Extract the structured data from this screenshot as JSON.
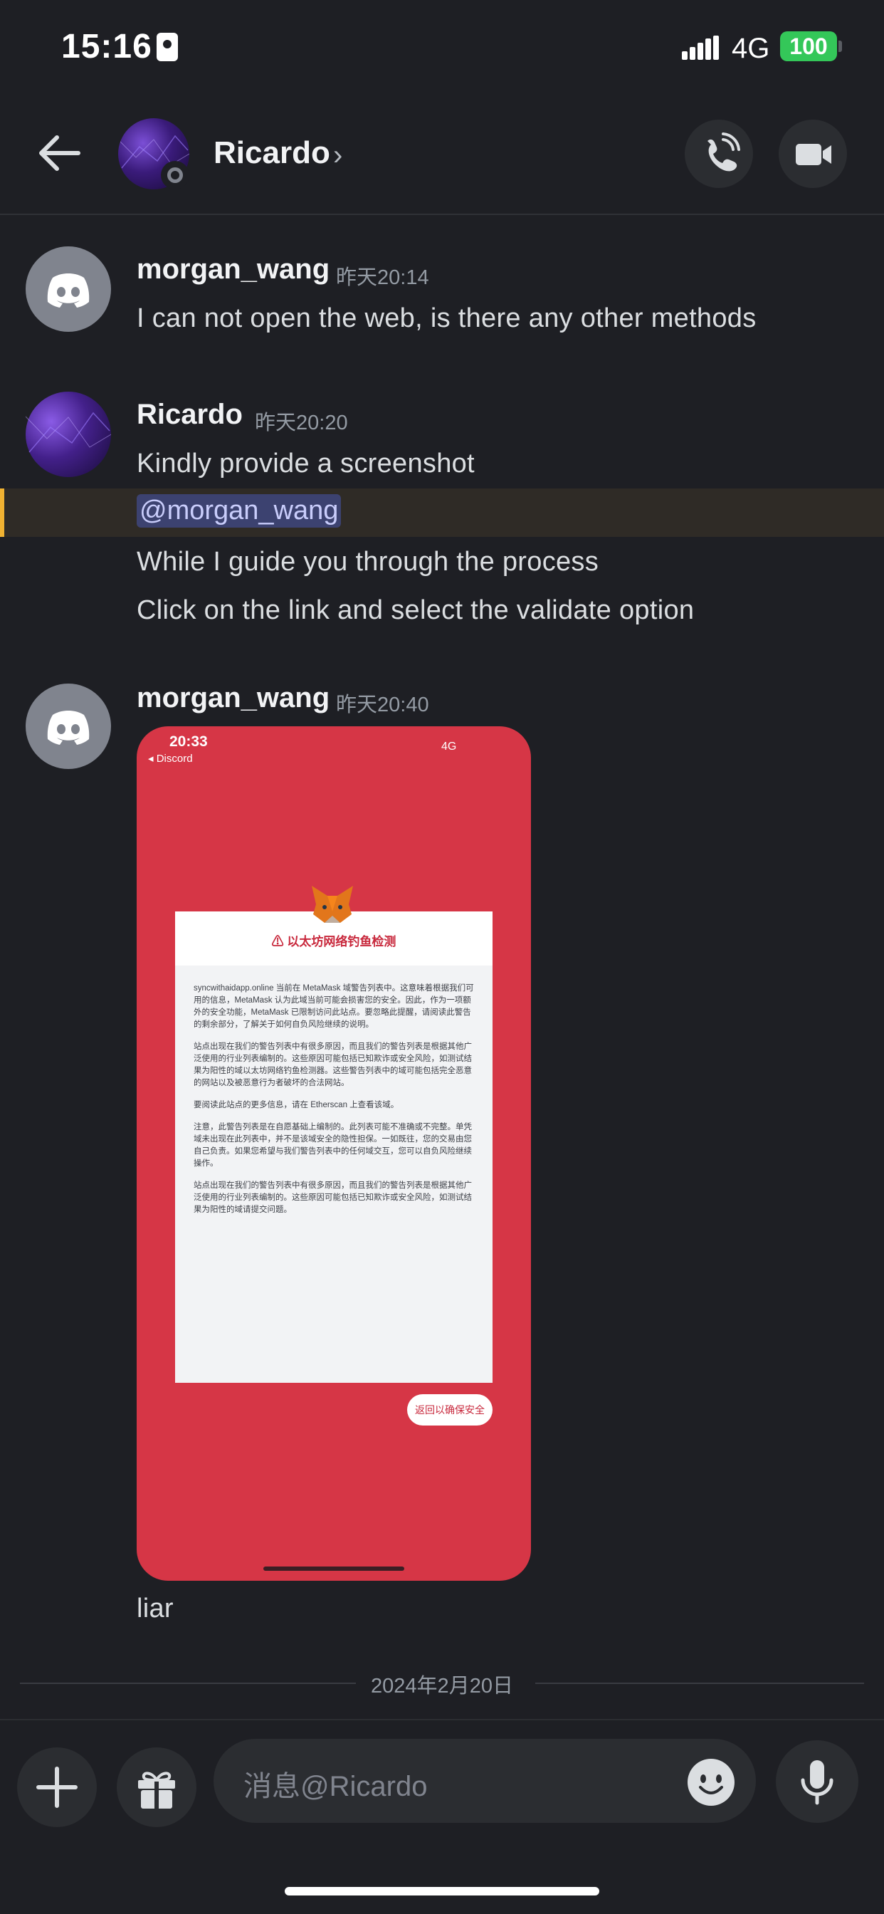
{
  "status_bar": {
    "time": "15:16",
    "network": "4G",
    "battery": "100"
  },
  "header": {
    "contact_name": "Ricardo",
    "chevron": "›"
  },
  "messages": [
    {
      "username": "morgan_wang",
      "timestamp": "昨天20:14",
      "lines": [
        "I can not open the web, is there any other methods"
      ]
    },
    {
      "username": "Ricardo",
      "timestamp": "昨天20:20",
      "lines": [
        "Kindly provide a screenshot",
        "@morgan_wang",
        "While I guide you through the process",
        "Click on the link and select the validate option"
      ]
    },
    {
      "username": "morgan_wang",
      "timestamp": "昨天20:40",
      "caption": "liar"
    }
  ],
  "attachment": {
    "time": "20:33",
    "back_label": "◂ Discord",
    "status": "4G",
    "title": "以太坊网络钓鱼检测",
    "body": [
      "syncwithaidapp.online 当前在 MetaMask 域警告列表中。这意味着根据我们可用的信息，MetaMask 认为此域当前可能会损害您的安全。因此，作为一项额外的安全功能，MetaMask 已限制访问此站点。要忽略此提醒，请阅读此警告的剩余部分，了解关于如何自负风险继续的说明。",
      "站点出现在我们的警告列表中有很多原因，而且我们的警告列表是根据其他广泛使用的行业列表编制的。这些原因可能包括已知欺诈或安全风险，如测试结果为阳性的域以太坊网络钓鱼检测器。这些警告列表中的域可能包括完全恶意的网站以及被恶意行为者破坏的合法网站。",
      "要阅读此站点的更多信息，请在 Etherscan 上查看该域。",
      "注意，此警告列表是在自愿基础上编制的。此列表可能不准确或不完整。单凭域未出现在此列表中，并不是该域安全的隐性担保。一如既往，您的交易由您自己负责。如果您希望与我们警告列表中的任何域交互，您可以自负风险继续操作。",
      "站点出现在我们的警告列表中有很多原因，而且我们的警告列表是根据其他广泛使用的行业列表编制的。这些原因可能包括已知欺诈或安全风险，如测试结果为阳性的域请提交问题。"
    ],
    "button": "返回以确保安全"
  },
  "date_divider": "2024年2月20日",
  "composer": {
    "placeholder": "消息@Ricardo"
  },
  "colors": {
    "background": "#1e1f24",
    "mention_bar": "#f0b232",
    "battery": "#34c759",
    "attachment_bg": "#d63646"
  },
  "icons": [
    "back-arrow-icon",
    "phone-call-icon",
    "video-camera-icon",
    "discord-logo-icon",
    "plus-icon",
    "gift-icon",
    "emoji-icon",
    "microphone-icon",
    "metamask-fox-icon",
    "warning-icon"
  ]
}
